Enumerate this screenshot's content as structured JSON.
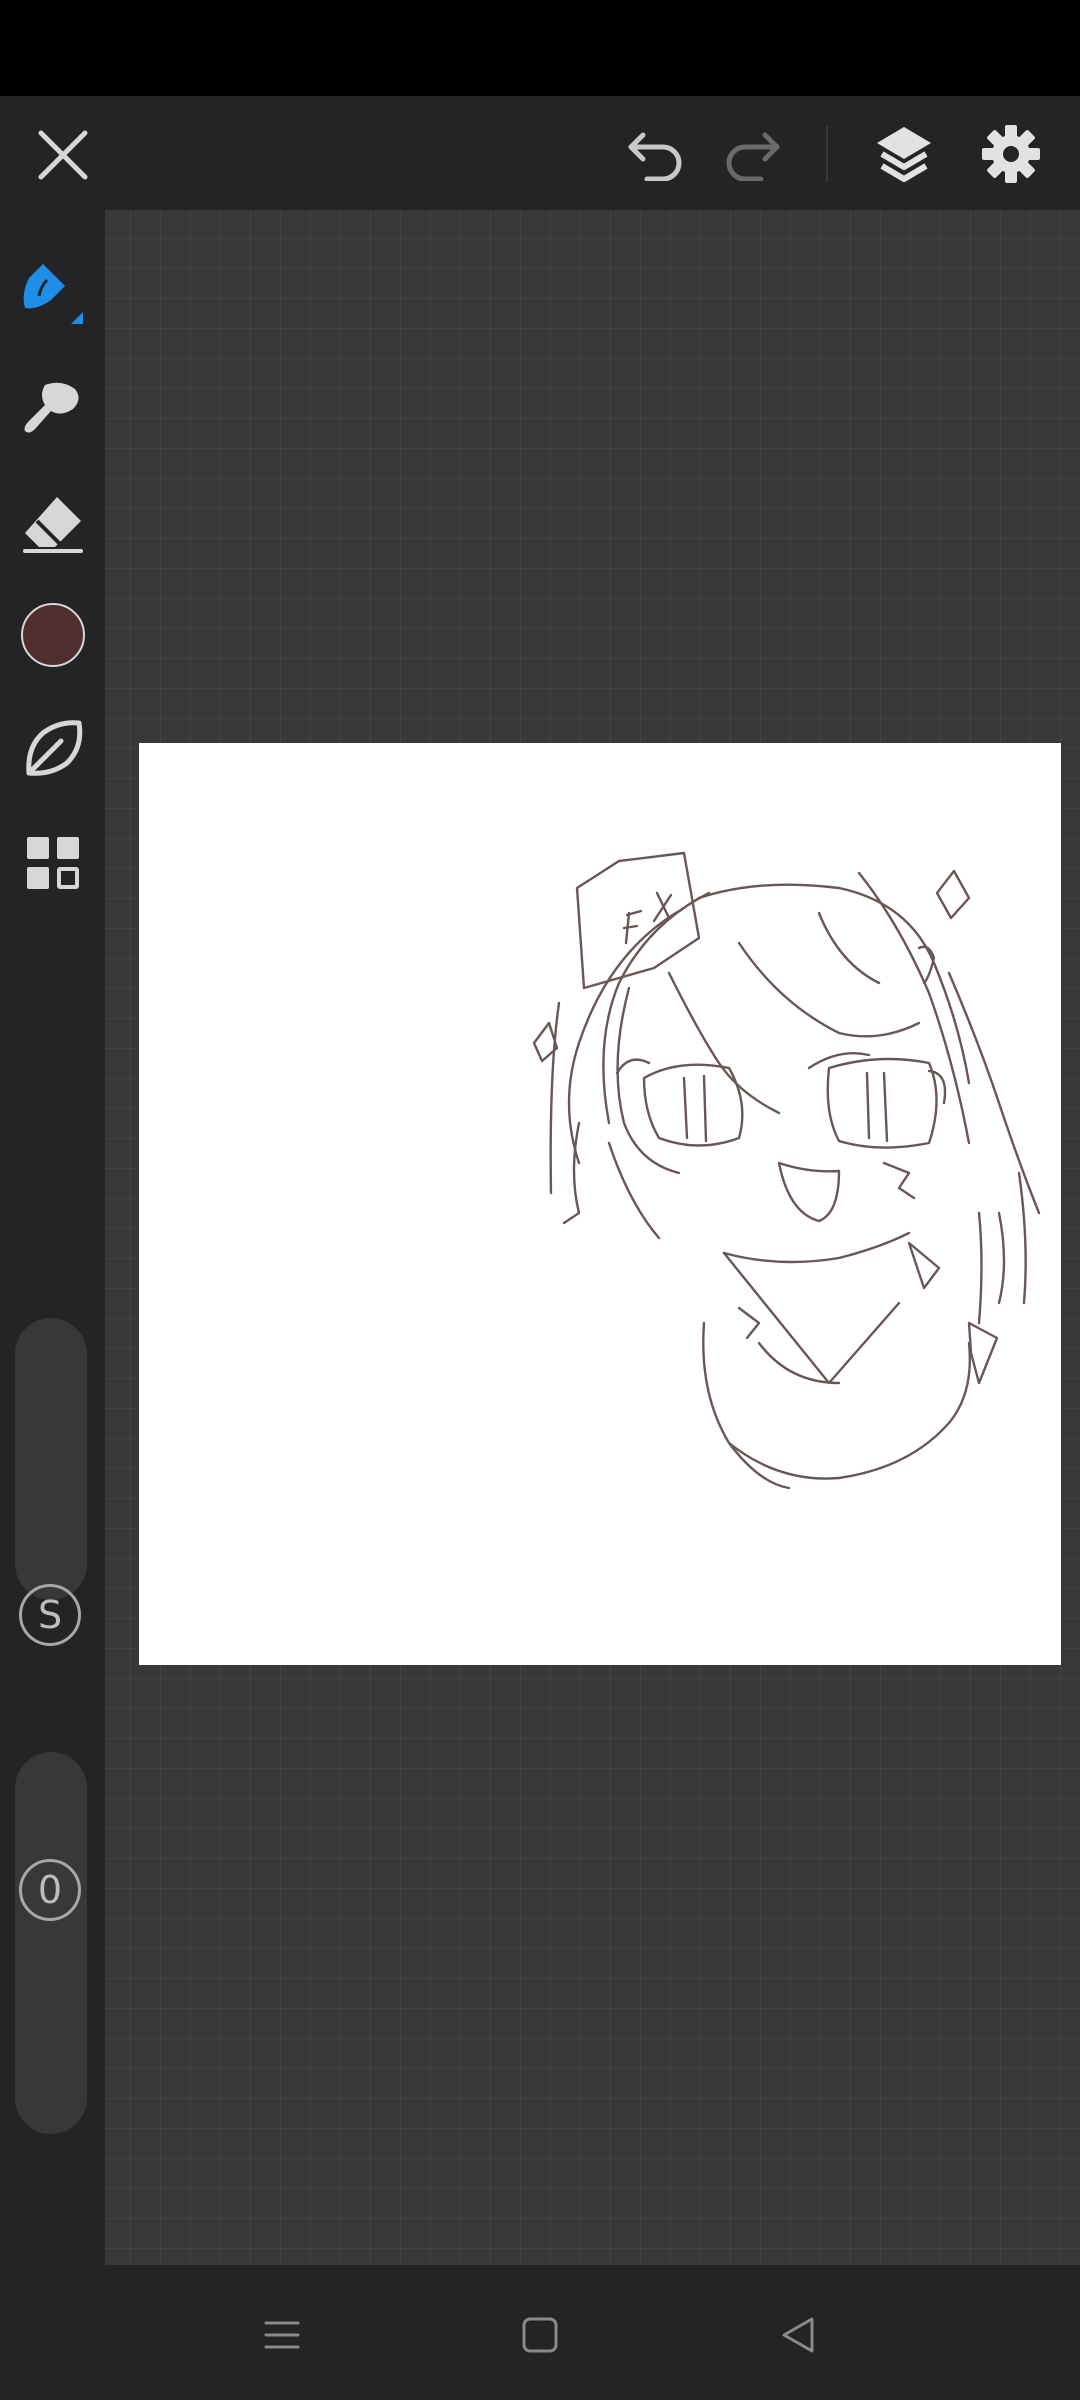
{
  "top_bar": {
    "icons": [
      "close-icon",
      "undo-icon",
      "redo-icon",
      "layers-icon",
      "gear-icon"
    ]
  },
  "toolbar": {
    "tools": [
      "pen-icon",
      "brush-icon",
      "eraser-icon",
      "color-swatch",
      "leaf-icon",
      "grid-icon"
    ],
    "current_color": "#4e2e2e",
    "accent_color": "#1e8fe8"
  },
  "sliders": {
    "size_label": "S",
    "opacity_label": "0"
  },
  "nav_bar": {
    "icons": [
      "menu-icon",
      "home-icon",
      "back-icon"
    ]
  }
}
